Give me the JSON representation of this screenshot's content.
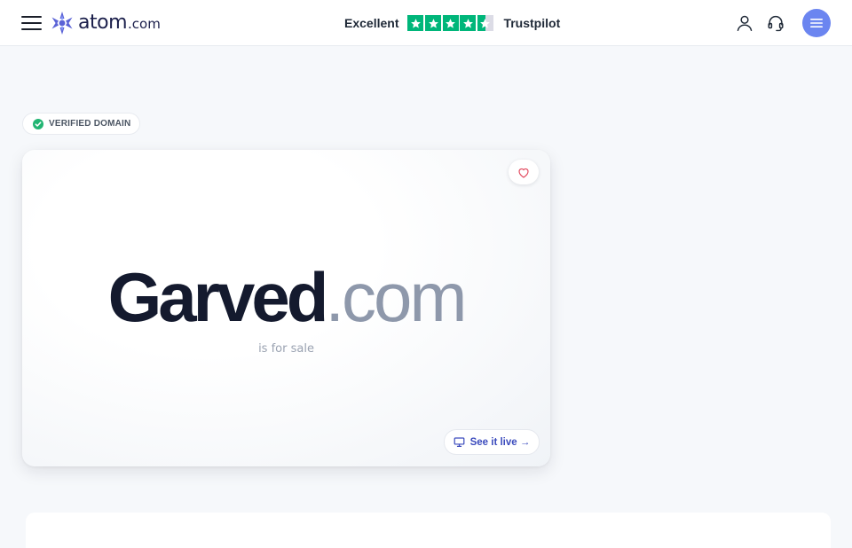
{
  "header": {
    "logo": {
      "name": "atom",
      "suffix": ".com"
    },
    "trust": {
      "rating": "Excellent",
      "brand": "Trustpilot",
      "stars": 4.5
    },
    "icons": [
      "menu-icon",
      "atom-logo-icon",
      "user-icon",
      "headset-icon",
      "list-icon"
    ]
  },
  "badge": {
    "label": "VERIFIED DOMAIN"
  },
  "card": {
    "sld": "Garved",
    "tld": ".com",
    "status": "is for sale",
    "see_live": "See it live →"
  },
  "colors": {
    "accent": "#6b85f0",
    "trustpilot_green": "#00b67a",
    "verified_green": "#22b573",
    "link_blue": "#3b4bbd",
    "favorite_red": "#e24a5f"
  }
}
